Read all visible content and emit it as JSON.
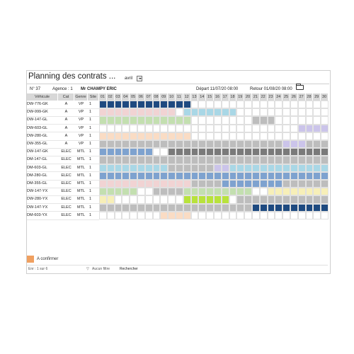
{
  "header": {
    "title": "Planning des contrats ...",
    "month": "avril"
  },
  "info": {
    "number": "N° 37",
    "agence": "Agence : 1",
    "client": "Mr CHAMPY ERIC",
    "depart": "Départ  11/07/20 08:00",
    "retour": "Retour  01/08/20 08:00"
  },
  "columns": {
    "vehicule": "Véhicule",
    "cat": "Cat",
    "genre": "Genre",
    "site": "Site"
  },
  "days": [
    "01",
    "02",
    "03",
    "04",
    "05",
    "06",
    "07",
    "08",
    "09",
    "10",
    "11",
    "12",
    "13",
    "14",
    "15",
    "16",
    "17",
    "18",
    "19",
    "20",
    "21",
    "22",
    "23",
    "24",
    "25",
    "26",
    "27",
    "28",
    "29",
    "30"
  ],
  "colors": {
    "navy": "#1e4a80",
    "pink": "#f1d3d3",
    "lightblue": "#a9d7e6",
    "green": "#c3dfb0",
    "gray": "#bdbdbd",
    "lavender": "#cbc4ea",
    "peach": "#fadcc4",
    "steel": "#7ea2cf",
    "dark": "#7a7a7a",
    "bright": "#b8e23c",
    "yellow": "#f7efb8",
    "white": "#ffffff"
  },
  "rows": [
    {
      "vehicule": "DW-776-GK",
      "cat": "A",
      "genre": "VP",
      "site": "1",
      "segments": [
        [
          "navy",
          1,
          12
        ]
      ]
    },
    {
      "vehicule": "DW-999-GK",
      "cat": "A",
      "genre": "VP",
      "site": "1",
      "segments": [
        [
          "pink",
          1,
          10
        ],
        [
          "lightblue",
          12,
          18
        ]
      ]
    },
    {
      "vehicule": "DW-147-GL",
      "cat": "A",
      "genre": "VP",
      "site": "1",
      "segments": [
        [
          "green",
          1,
          12
        ],
        [
          "gray",
          21,
          23
        ]
      ]
    },
    {
      "vehicule": "DW-603-GL",
      "cat": "A",
      "genre": "VP",
      "site": "1",
      "segments": [
        [
          "lavender",
          27,
          30
        ]
      ]
    },
    {
      "vehicule": "DW-280-GL",
      "cat": "A",
      "genre": "VP",
      "site": "1",
      "segments": [
        [
          "peach",
          1,
          12
        ]
      ]
    },
    {
      "vehicule": "DW-355-GL",
      "cat": "A",
      "genre": "VP",
      "site": "1",
      "segments": [
        [
          "gray",
          1,
          24
        ],
        [
          "lavender",
          25,
          27
        ],
        [
          "gray",
          28,
          30
        ]
      ]
    },
    {
      "vehicule": "DW-147-GK",
      "cat": "ELEC",
      "genre": "MTL",
      "site": "1",
      "segments": [
        [
          "steel",
          1,
          7
        ],
        [
          "dark",
          10,
          30
        ]
      ]
    },
    {
      "vehicule": "DM-147-GL",
      "cat": "ELEC",
      "genre": "MTL",
      "site": "1",
      "segments": [
        [
          "gray",
          1,
          30
        ]
      ]
    },
    {
      "vehicule": "DM-603-GL",
      "cat": "ELEC",
      "genre": "MTL",
      "site": "1",
      "segments": [
        [
          "lightblue",
          1,
          9
        ],
        [
          "gray",
          10,
          15
        ],
        [
          "lavender",
          16,
          17
        ],
        [
          "lightblue",
          18,
          30
        ]
      ]
    },
    {
      "vehicule": "DM-280-GL",
      "cat": "ELEC",
      "genre": "MTL",
      "site": "1",
      "segments": [
        [
          "steel",
          1,
          30
        ]
      ]
    },
    {
      "vehicule": "DM-355-GL",
      "cat": "ELEC",
      "genre": "MTL",
      "site": "1",
      "segments": [
        [
          "pink",
          1,
          12
        ],
        [
          "gray",
          13,
          16
        ],
        [
          "steel",
          17,
          24
        ],
        [
          "gray",
          25,
          30
        ]
      ]
    },
    {
      "vehicule": "DW-147-YX",
      "cat": "ELEC",
      "genre": "MTL",
      "site": "1",
      "segments": [
        [
          "green",
          1,
          5
        ],
        [
          "gray",
          8,
          11
        ],
        [
          "green",
          12,
          20
        ],
        [
          "yellow",
          23,
          30
        ]
      ]
    },
    {
      "vehicule": "DW-280-YX",
      "cat": "ELEC",
      "genre": "MTL",
      "site": "1",
      "segments": [
        [
          "yellow",
          1,
          2
        ],
        [
          "bright",
          12,
          17
        ],
        [
          "gray",
          19,
          24
        ],
        [
          "gray",
          25,
          30
        ]
      ]
    },
    {
      "vehicule": "DW-147-YX",
      "cat": "ELEC",
      "genre": "MTL",
      "site": "1",
      "segments": [
        [
          "gray",
          1,
          20
        ],
        [
          "navy",
          21,
          30
        ]
      ]
    },
    {
      "vehicule": "DM-603-YX",
      "cat": "ELEC",
      "genre": "MTL",
      "site": "1",
      "segments": [
        [
          "peach",
          9,
          12
        ]
      ]
    }
  ],
  "legend": {
    "label": "A confirmer",
    "color": "#f0a060"
  },
  "footer": {
    "nav": "Enr : 1 sur 6",
    "filter": "Aucun filtre",
    "search": "Rechercher"
  }
}
